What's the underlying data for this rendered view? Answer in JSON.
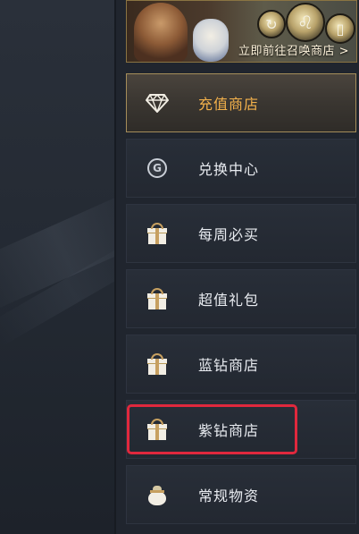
{
  "banner": {
    "text": "立即前往召唤商店 >"
  },
  "menu": {
    "items": [
      {
        "label": "充值商店",
        "icon": "diamond-icon",
        "active": true
      },
      {
        "label": "兑换中心",
        "icon": "coin-icon",
        "active": false
      },
      {
        "label": "每周必买",
        "icon": "gift-icon",
        "active": false
      },
      {
        "label": "超值礼包",
        "icon": "gift-icon",
        "active": false
      },
      {
        "label": "蓝钻商店",
        "icon": "gift-icon",
        "active": false
      },
      {
        "label": "紫钻商店",
        "icon": "gift-icon",
        "active": false,
        "highlighted": true
      },
      {
        "label": "常规物资",
        "icon": "money-bag-icon",
        "active": false
      }
    ]
  },
  "colors": {
    "accent_gold": "#f3b14b",
    "highlight_red": "#e0283d",
    "item_bg": "#262b34",
    "text_light": "#e9ecf1"
  }
}
